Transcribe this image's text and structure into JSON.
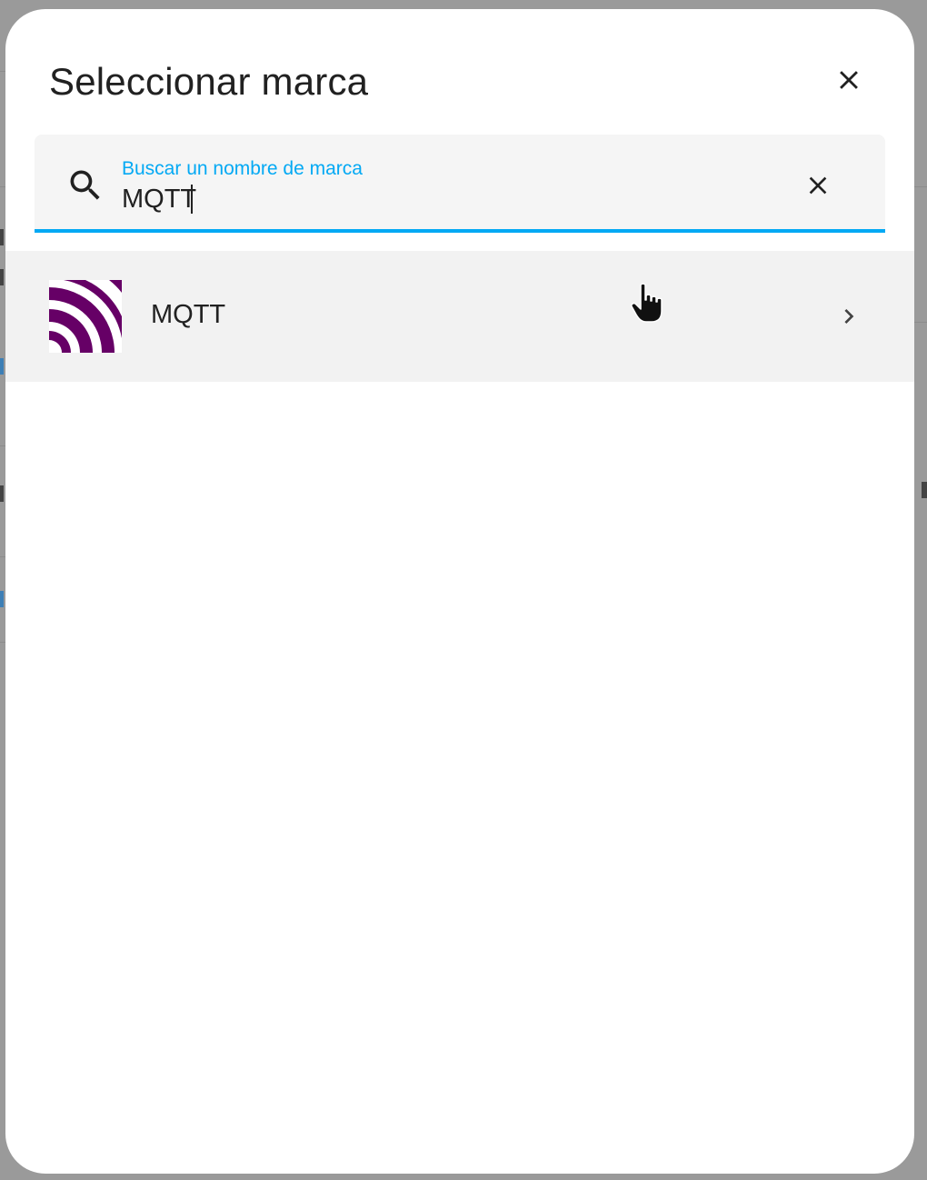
{
  "dialog": {
    "title": "Seleccionar marca",
    "close_icon": "close-icon"
  },
  "search": {
    "label": "Buscar un nombre de marca",
    "value": "MQTT",
    "search_icon": "magnify-icon",
    "clear_icon": "close-icon"
  },
  "results": [
    {
      "label": "MQTT",
      "logo": "mqtt-logo",
      "chevron_icon": "chevron-right-icon"
    }
  ],
  "colors": {
    "accent": "#03a9f4",
    "mqtt_logo": "#660066",
    "row_hover": "#f2f2f2",
    "field_bg": "#f5f5f5"
  }
}
